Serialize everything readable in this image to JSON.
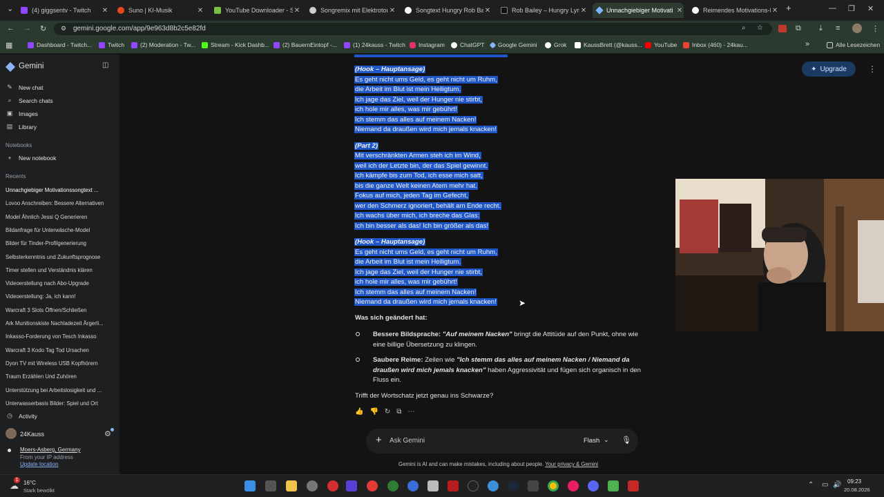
{
  "tabs": [
    {
      "label": "(4) giggsentv - Twitch",
      "icon": "twitch-icon",
      "color": "#9146ff"
    },
    {
      "label": "Suno | KI-Musik",
      "icon": "suno-icon",
      "color": "#e8491f"
    },
    {
      "label": "YouTube Downloader - S",
      "icon": "download-icon",
      "color": "#7bc043"
    },
    {
      "label": "Songremix mit Elektrotou",
      "icon": "gemini-icon",
      "color": "#cfcfcf"
    },
    {
      "label": "Songtext Hungry Rob Ba",
      "icon": "google-icon",
      "color": "#ffffff"
    },
    {
      "label": "Rob Bailey – Hungry Lyric",
      "icon": "genius-icon",
      "color": "#111111"
    },
    {
      "label": "Unnachgiebiger Motivati",
      "icon": "gemini-icon",
      "color": "#7ab6ff"
    },
    {
      "label": "Reimendes Motivations-I",
      "icon": "chatgpt-icon",
      "color": "#ffffff"
    }
  ],
  "address_bar": {
    "url": "gemini.google.com/app/9e963d8b2c5e82fd"
  },
  "bookmarks": [
    {
      "label": "Dashboard - Twitch...",
      "color": "#9146ff"
    },
    {
      "label": "Twitch",
      "color": "#9146ff"
    },
    {
      "label": "(2) Moderation - Tw...",
      "color": "#9146ff"
    },
    {
      "label": "Stream - Kick Dashb...",
      "color": "#53fc18"
    },
    {
      "label": "(2) BauernEintopf -...",
      "color": "#9146ff"
    },
    {
      "label": "(1) 24kauss - Twitch",
      "color": "#9146ff"
    },
    {
      "label": "Instagram",
      "color": "#e1306c"
    },
    {
      "label": "ChatGPT",
      "color": "#ffffff"
    },
    {
      "label": "Google Gemini",
      "color": "#8ab4f8"
    },
    {
      "label": "Grok",
      "color": "#ffffff"
    },
    {
      "label": "KaussBrett (@kauss...",
      "color": "#ffffff"
    },
    {
      "label": "YouTube",
      "color": "#ff0000"
    },
    {
      "label": "Inbox (460) - 24kau...",
      "color": "#ea4335"
    }
  ],
  "bookmarks_more": "»",
  "bookmarks_all": "Alle Lesezeichen",
  "sidebar": {
    "app_name": "Gemini",
    "new_chat": "New chat",
    "search_chats": "Search chats",
    "images": "Images",
    "library": "Library",
    "notebooks_title": "Notebooks",
    "new_notebook": "New notebook",
    "recents_title": "Recents",
    "recents": [
      "Unnachgiebiger Motivationssongtext ...",
      "Lovoo Anschreiben: Bessere Alternativen",
      "Model Ähnlich Jessi Q Generieren",
      "Bildanfrage für Unterwäsche-Model",
      "Bilder für Tinder-Profilgenerierung",
      "Selbsterkenntnis und Zukunftsprognose",
      "Timer stellen und Verständnis klären",
      "Videoerstellung nach Abo-Upgrade",
      "Videoerstellung: Ja, ich kann!",
      "Warcraft 3 Slots Öffnen/Schließen",
      "Ark Munitionskiste Nachladezeit Ärgerli...",
      "Inkasso-Forderung von Tesch Inkasso",
      "Warcraft 3 Kodo Tag Tod Ursachen",
      "Dyon TV mit Wireless USB Kopfhörern",
      "Traum Erzählen Und Zuhören",
      "Unterstützung bei Arbeitslosigkeit und ...",
      "Unterwasserbasis Bilder: Spiel und Ort"
    ],
    "activity": "Activity",
    "user": "24Kauss",
    "location": "Moers-Asberg, Germany",
    "location_source": "From your IP address",
    "update_location": "Update location"
  },
  "upgrade_label": "Upgrade",
  "lyrics": {
    "hook1_header": "(Hook – Hauptansage)",
    "hook1": [
      "Es geht nicht ums Geld, es geht nicht um Ruhm,",
      "die Arbeit im Blut ist mein Heiligtum.",
      "Ich jage das Ziel, weil der Hunger nie stirbt,",
      "ich hole mir alles, was mir gebührt!",
      "Ich stemm das alles auf meinem Nacken!",
      "Niemand da draußen wird mich jemals knacken!"
    ],
    "part2_header": "(Part 2)",
    "part2": [
      "Mit verschränkten Armen steh ich im Wind,",
      "weil ich der Letzte bin, der das Spiel gewinnt.",
      "Ich kämpfe bis zum Tod, ich esse mich satt,",
      "bis die ganze Welt keinen Atem mehr hat.",
      "Fokus auf mich, jeden Tag im Gefecht,",
      "wer den Schmerz ignoriert, behält am Ende recht.",
      "Ich wachs über mich, ich breche das Glas:",
      "Ich bin besser als das! Ich bin größer als das!"
    ],
    "hook2_header": "(Hook – Hauptansage)",
    "hook2": [
      "Es geht nicht ums Geld, es geht nicht um Ruhm,",
      "die Arbeit im Blut ist mein Heiligtum.",
      "Ich jage das Ziel, weil der Hunger nie stirbt,",
      "ich hole mir alles, was mir gebührt!",
      "Ich stemm das alles auf meinem Nacken!",
      "Niemand da draußen wird mich jemals knacken!"
    ]
  },
  "changes": {
    "title": "Was sich geändert hat:",
    "b1_bold": "Bessere Bildsprache:",
    "b1_quote": "\"Auf meinem Nacken\"",
    "b1_rest1": "bringt die Attitüde auf den Punkt, ohne wie",
    "b1_rest2": "eine billige Übersetzung zu klingen.",
    "b2_bold": "Saubere Reime:",
    "b2_pre": "Zeilen wie",
    "b2_quote1": "\"Ich stemm das alles auf meinem Nacken / Niemand da",
    "b2_quote2": "draußen wird mich jemals knacken\"",
    "b2_rest2": "haben Aggressivität und fügen sich organisch in den",
    "b2_rest3": "Fluss ein.",
    "question": "Trifft der Wortschatz jetzt genau ins Schwarze?"
  },
  "composer": {
    "placeholder": "Ask Gemini",
    "model": "Flash"
  },
  "disclaimer": {
    "text": "Gemini is AI and can make mistakes, including about people.",
    "link": "Your privacy & Gemini"
  },
  "taskbar": {
    "weather_temp": "16°C",
    "weather_desc": "Stark bewölkt",
    "notification_count": "1",
    "time": "09:23",
    "date": "20.08.2026"
  }
}
